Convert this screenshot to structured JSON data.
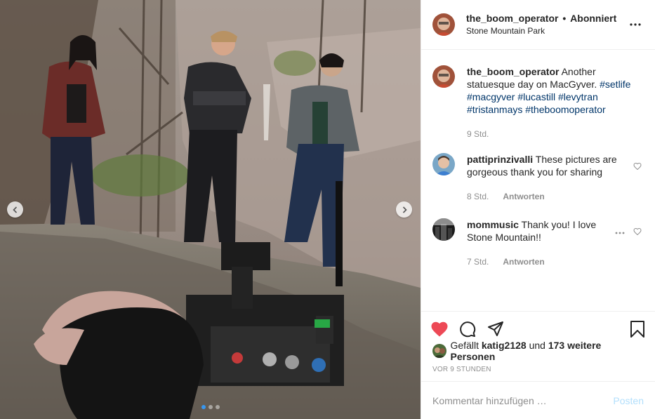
{
  "post": {
    "username": "the_boom_operator",
    "separator": "•",
    "follow_status": "Abonniert",
    "location": "Stone Mountain Park",
    "more_icon": "more-horizontal-icon"
  },
  "caption": {
    "username": "the_boom_operator",
    "text": " Another statuesque day on MacGyver. ",
    "hashtags": [
      "#setlife",
      "#macgyver",
      "#lucastill",
      "#levytran",
      "#tristanmays",
      "#theboomoperator"
    ],
    "time": "9 Std."
  },
  "comments": [
    {
      "username": "pattiprinzivalli",
      "text": " These pictures are gorgeous thank you for sharing",
      "time": "8 Std.",
      "reply": "Antworten"
    },
    {
      "username": "mommusic",
      "text": " Thank you! I love Stone Mountain!!",
      "time": "7 Std.",
      "reply": "Antworten"
    }
  ],
  "actions": {
    "like_icon": "heart-filled-icon",
    "comment_icon": "comment-icon",
    "share_icon": "share-icon",
    "save_icon": "bookmark-icon",
    "like_color": "#ed4956"
  },
  "likes": {
    "prefix": "Gefällt ",
    "user": "katig2128",
    "middle": " und ",
    "others": "173 weitere Personen"
  },
  "timestamp": "VOR 9 STUNDEN",
  "add_comment": {
    "placeholder": "Kommentar hinzufügen …",
    "post_label": "Posten"
  },
  "carousel": {
    "count": 3,
    "active_index": 0
  },
  "colors": {
    "link": "#003569",
    "accent_blue": "#3897f0",
    "post_button_disabled": "#b2dffc",
    "muted": "#8e8e8e"
  }
}
